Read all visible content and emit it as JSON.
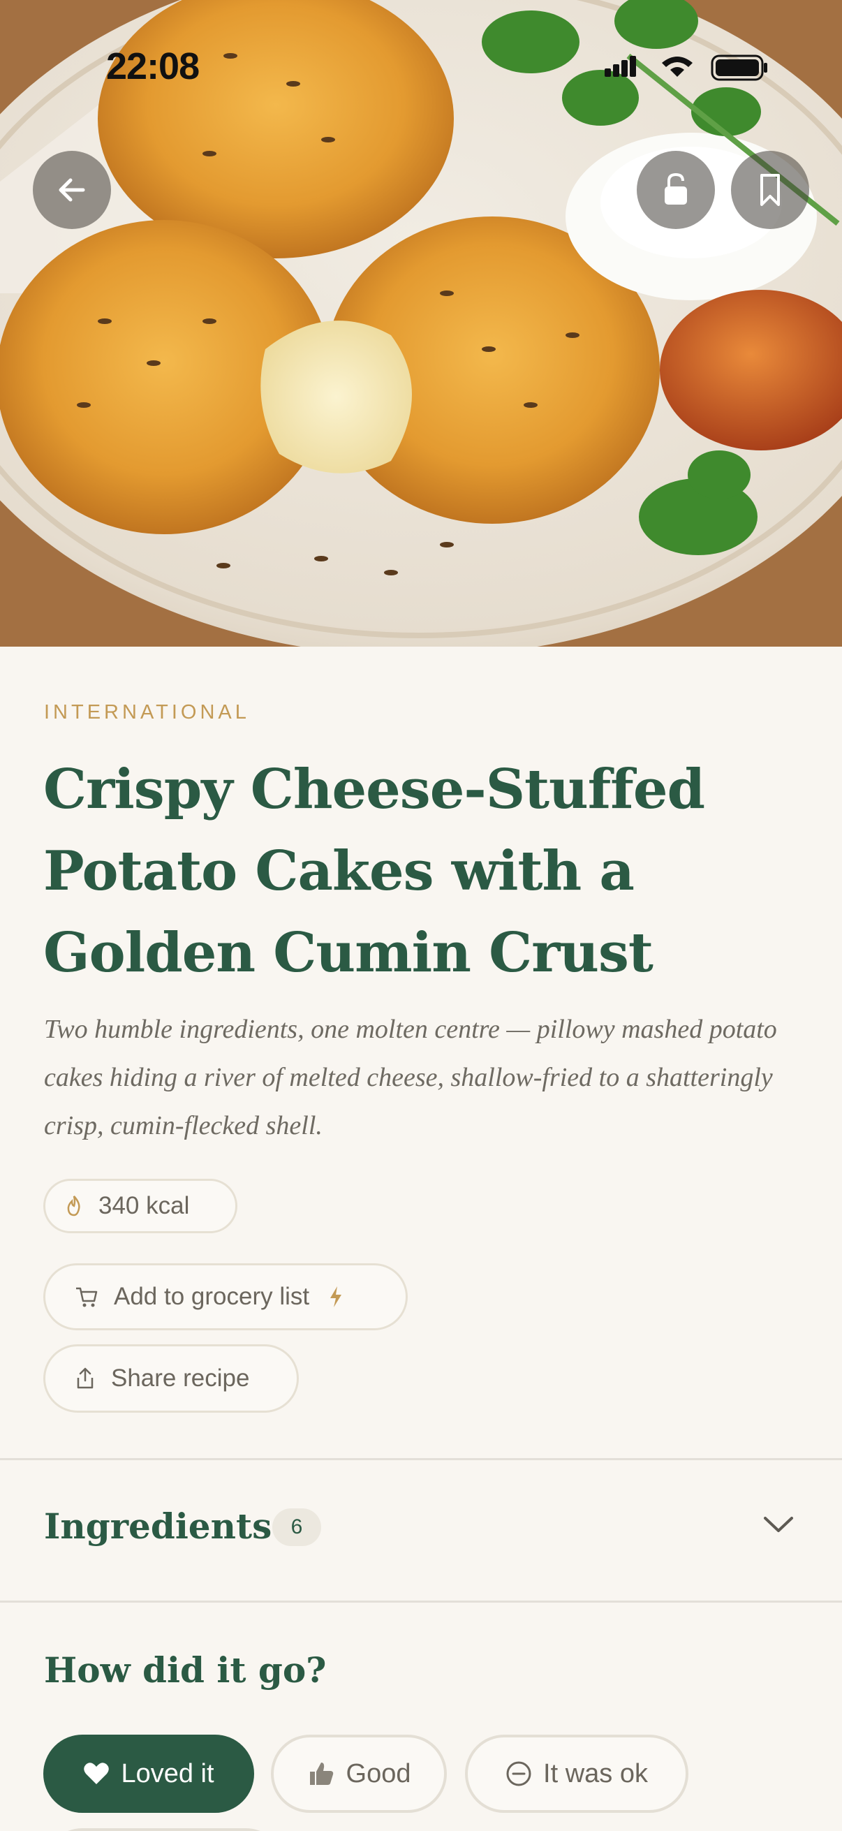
{
  "status_bar": {
    "time": "22:08"
  },
  "hero": {
    "back_icon": "arrow-left-icon",
    "lock_icon": "unlock-icon",
    "bookmark_icon": "bookmark-icon"
  },
  "recipe": {
    "category": "INTERNATIONAL",
    "title": "Crispy Cheese-Stuffed Potato Cakes with a Golden Cumin Crust",
    "description": "Two humble ingredients, one molten centre — pillowy mashed potato cakes hiding a river of melted cheese, shallow-fried to a shatteringly crisp, cumin-flecked shell.",
    "calories": "340 kcal"
  },
  "actions": {
    "grocery_label": "Add to grocery list",
    "share_label": "Share recipe"
  },
  "ingredients": {
    "label": "Ingredients",
    "count": "6"
  },
  "feedback": {
    "question": "How did it go?",
    "options": [
      "Loved it",
      "Good",
      "It was ok"
    ]
  },
  "colors": {
    "accent": "#2b5a44",
    "category": "#c39a55",
    "background": "#f9f6f1"
  }
}
